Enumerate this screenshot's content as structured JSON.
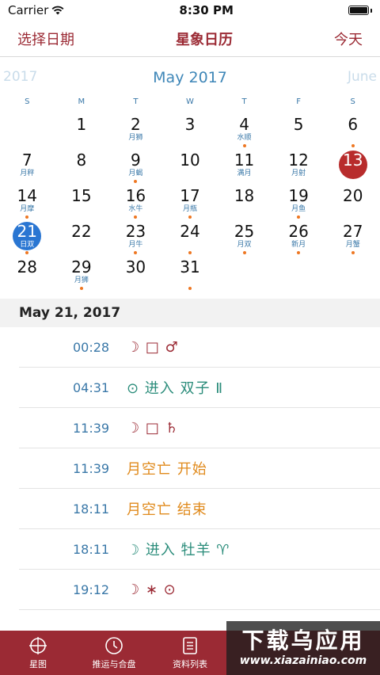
{
  "status_bar": {
    "carrier": "Carrier",
    "time": "8:30 PM"
  },
  "nav": {
    "left_button": "选择日期",
    "title": "星象日历",
    "right_button": "今天"
  },
  "calendar": {
    "prev_month": "2017",
    "current_month": "May 2017",
    "next_month": "June",
    "weekdays": [
      "S",
      "M",
      "T",
      "W",
      "T",
      "F",
      "S"
    ],
    "weeks": [
      [
        {
          "num": "",
          "sub": "",
          "dot": false
        },
        {
          "num": "1",
          "sub": "",
          "dot": false
        },
        {
          "num": "2",
          "sub": "月狮",
          "dot": false
        },
        {
          "num": "3",
          "sub": "",
          "dot": false
        },
        {
          "num": "4",
          "sub": "水顺",
          "dot": true
        },
        {
          "num": "5",
          "sub": "",
          "dot": false
        },
        {
          "num": "6",
          "sub": "",
          "dot": true
        }
      ],
      [
        {
          "num": "7",
          "sub": "月秤",
          "dot": false
        },
        {
          "num": "8",
          "sub": "",
          "dot": false
        },
        {
          "num": "9",
          "sub": "月蝎",
          "dot": true
        },
        {
          "num": "10",
          "sub": "",
          "dot": false
        },
        {
          "num": "11",
          "sub": "满月",
          "dot": false
        },
        {
          "num": "12",
          "sub": "月射",
          "dot": false
        },
        {
          "num": "13",
          "sub": "",
          "dot": false,
          "state": "today"
        }
      ],
      [
        {
          "num": "14",
          "sub": "月摩",
          "dot": true
        },
        {
          "num": "15",
          "sub": "",
          "dot": false
        },
        {
          "num": "16",
          "sub": "水牛",
          "dot": true
        },
        {
          "num": "17",
          "sub": "月瓶",
          "dot": true
        },
        {
          "num": "18",
          "sub": "",
          "dot": false
        },
        {
          "num": "19",
          "sub": "月鱼",
          "dot": true
        },
        {
          "num": "20",
          "sub": "",
          "dot": false
        }
      ],
      [
        {
          "num": "21",
          "sub": "日双",
          "dot": true,
          "state": "selected"
        },
        {
          "num": "22",
          "sub": "",
          "dot": false
        },
        {
          "num": "23",
          "sub": "月牛",
          "dot": true
        },
        {
          "num": "24",
          "sub": "",
          "dot": true
        },
        {
          "num": "25",
          "sub": "月双",
          "dot": true
        },
        {
          "num": "26",
          "sub": "新月",
          "dot": true
        },
        {
          "num": "27",
          "sub": "月蟹",
          "dot": true
        }
      ],
      [
        {
          "num": "28",
          "sub": "",
          "dot": false
        },
        {
          "num": "29",
          "sub": "月狮",
          "dot": true
        },
        {
          "num": "30",
          "sub": "",
          "dot": false
        },
        {
          "num": "31",
          "sub": "",
          "dot": true
        },
        {
          "num": "",
          "sub": "",
          "dot": false
        },
        {
          "num": "",
          "sub": "",
          "dot": false
        },
        {
          "num": "",
          "sub": "",
          "dot": false
        }
      ]
    ]
  },
  "section_header": "May 21, 2017",
  "events": [
    {
      "time": "00:28",
      "text": "☽ □ ♂",
      "color": "red"
    },
    {
      "time": "04:31",
      "text": "⊙ 进入 双子 Ⅱ",
      "color": "green"
    },
    {
      "time": "11:39",
      "text": "☽ □ ♄",
      "color": "red"
    },
    {
      "time": "11:39",
      "text": "月空亡 开始",
      "color": "orange"
    },
    {
      "time": "18:11",
      "text": "月空亡 结束",
      "color": "orange"
    },
    {
      "time": "18:11",
      "text": "☽ 进入 牡羊 ♈",
      "color": "green"
    },
    {
      "time": "19:12",
      "text": "☽ ∗ ⊙",
      "color": "red"
    }
  ],
  "tabs": [
    {
      "label": "星图",
      "icon": "star-chart-icon"
    },
    {
      "label": "推运与合盘",
      "icon": "clock-icon"
    },
    {
      "label": "资料列表",
      "icon": "list-icon"
    }
  ],
  "watermark": {
    "main": "下载乌应用",
    "url": "www.xiazainiao.com"
  },
  "colors": {
    "accent": "#9b2a34",
    "blue": "#3a78a8",
    "today": "#b82c2c",
    "selected": "#2a76d2",
    "dot": "#ee7722"
  }
}
